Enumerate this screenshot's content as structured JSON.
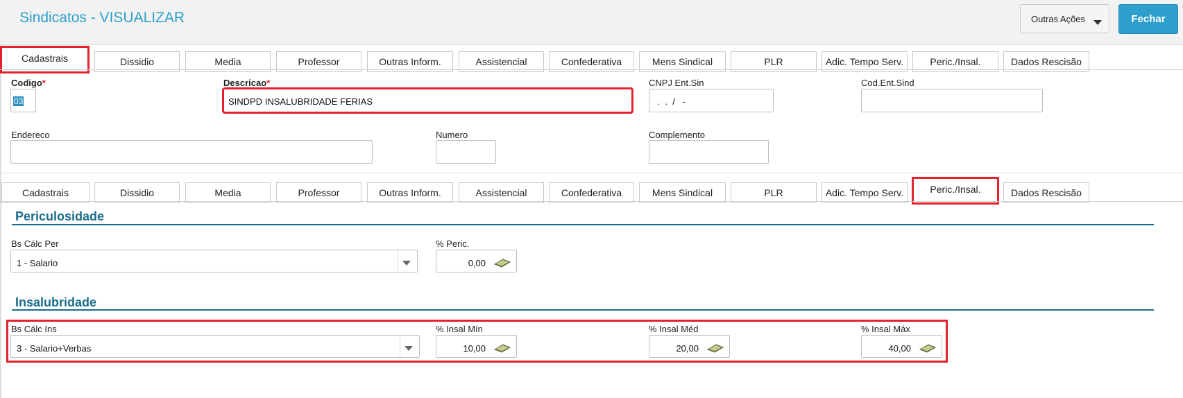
{
  "header": {
    "title": "Sindicatos - VISUALIZAR",
    "more_actions_label": "Outras Ações",
    "close_label": "Fechar"
  },
  "tabs": [
    "Cadastrais",
    "Dissidio",
    "Media",
    "Professor",
    "Outras Inform.",
    "Assistencial",
    "Confederativa",
    "Mens Sindical",
    "PLR",
    "Adic. Tempo Serv.",
    "Peric./Insal.",
    "Dados Rescisão"
  ],
  "top_tabs_active": "Cadastrais",
  "lower_tabs_active": "Peric./Insal.",
  "cadastrais": {
    "codigo_label": "Codigo",
    "codigo_value": "03",
    "descricao_label": "Descricao",
    "descricao_value": "SINDPD INSALUBRIDADE FERIAS",
    "cnpj_label": "CNPJ Ent.Sin",
    "cnpj_value": " .  .  /   -",
    "cod_ent_label": "Cod.Ent.Sind",
    "cod_ent_value": "",
    "endereco_label": "Endereco",
    "endereco_value": "",
    "numero_label": "Numero",
    "numero_value": "",
    "complemento_label": "Complemento",
    "complemento_value": "",
    "required_mark": "*"
  },
  "periculosidade": {
    "section_title": "Periculosidade",
    "bs_calc_label": "Bs Cálc Per",
    "bs_calc_value": "1 - Salario",
    "perc_label": "% Peric.",
    "perc_value": "0,00"
  },
  "insalubridade": {
    "section_title": "Insalubridade",
    "bs_calc_label": "Bs Cálc Ins",
    "bs_calc_value": "3 - Salario+Verbas",
    "min_label": "% Insal Mín",
    "min_value": "10,00",
    "med_label": "% Insal Méd",
    "med_value": "20,00",
    "max_label": "% Insal Máx",
    "max_value": "40,00"
  },
  "colors": {
    "accent": "#2b9fc9",
    "section": "#1b6b8c",
    "highlight": "#e3222e",
    "primary_button": "#2e9fcc"
  }
}
